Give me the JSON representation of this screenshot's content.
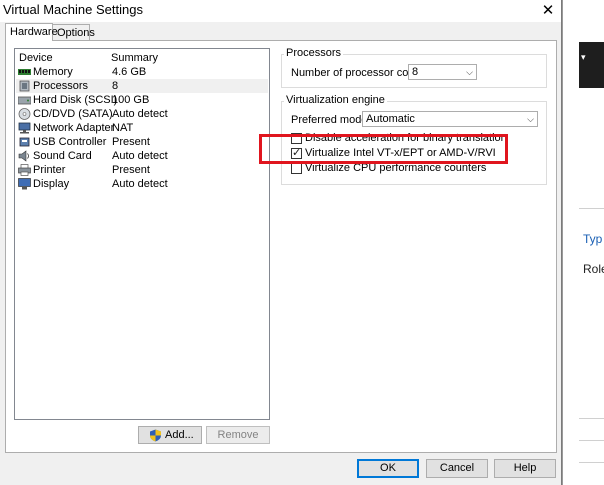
{
  "dialog": {
    "title": "Virtual Machine Settings",
    "close_glyph": "✕"
  },
  "tabs": [
    {
      "label": "Hardware",
      "selected": true
    },
    {
      "label": "Options",
      "selected": false
    }
  ],
  "device_list": {
    "columns": [
      "Device",
      "Summary"
    ],
    "rows": [
      {
        "device": "Memory",
        "summary": "4.6 GB",
        "icon": "memory-icon",
        "selected": false
      },
      {
        "device": "Processors",
        "summary": "8",
        "icon": "processor-icon",
        "selected": true
      },
      {
        "device": "Hard Disk (SCSI)",
        "summary": "100 GB",
        "icon": "hard-disk-icon",
        "selected": false
      },
      {
        "device": "CD/DVD (SATA)",
        "summary": "Auto detect",
        "icon": "cd-dvd-icon",
        "selected": false
      },
      {
        "device": "Network Adapter",
        "summary": "NAT",
        "icon": "network-adapter-icon",
        "selected": false
      },
      {
        "device": "USB Controller",
        "summary": "Present",
        "icon": "usb-icon",
        "selected": false
      },
      {
        "device": "Sound Card",
        "summary": "Auto detect",
        "icon": "sound-card-icon",
        "selected": false
      },
      {
        "device": "Printer",
        "summary": "Present",
        "icon": "printer-icon",
        "selected": false
      },
      {
        "device": "Display",
        "summary": "Auto detect",
        "icon": "display-icon",
        "selected": false
      }
    ]
  },
  "list_buttons": {
    "add": "Add...",
    "remove": "Remove"
  },
  "processors": {
    "group_title": "Processors",
    "cores_label": "Number of processor cores:",
    "cores_value": "8"
  },
  "virtualization": {
    "group_title": "Virtualization engine",
    "mode_label": "Preferred mode:",
    "mode_value": "Automatic",
    "options": [
      {
        "label": "Disable acceleration for binary translation",
        "checked": false
      },
      {
        "label": "Virtualize Intel VT-x/EPT or AMD-V/RVI",
        "checked": true
      },
      {
        "label": "Virtualize CPU performance counters",
        "checked": false
      }
    ]
  },
  "footer_buttons": {
    "ok": "OK",
    "cancel": "Cancel",
    "help": "Help"
  },
  "background_window": {
    "type_text": "Typ",
    "role_text": "Role",
    "caret_glyph": "▾"
  },
  "colors": {
    "highlight_box": "#e0151e",
    "link_blue": "#1a5fb4"
  }
}
